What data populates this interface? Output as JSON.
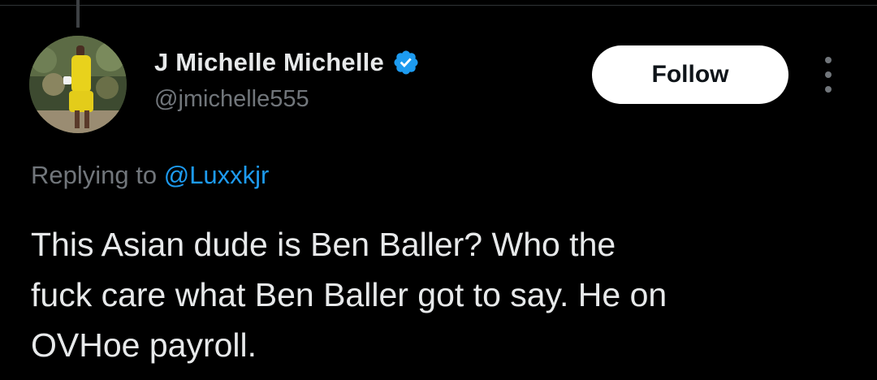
{
  "tweet": {
    "author": {
      "display_name": "J Michelle Michelle",
      "handle": "@jmichelle555",
      "verified": true,
      "avatar_icon": "profile-photo"
    },
    "follow_label": "Follow",
    "more_icon": "more-options-icon",
    "reply_prefix": "Replying to",
    "reply_mention": "@Luxxkjr",
    "text": "This Asian dude is Ben Baller? Who the\nfuck care what Ben Baller got to say. He on\nOVHoe payroll."
  },
  "colors": {
    "background": "#000000",
    "text_primary": "#e7e9ea",
    "text_secondary": "#71767b",
    "accent": "#1d9bf0",
    "button_bg": "#ffffff",
    "button_text": "#0f1419"
  }
}
